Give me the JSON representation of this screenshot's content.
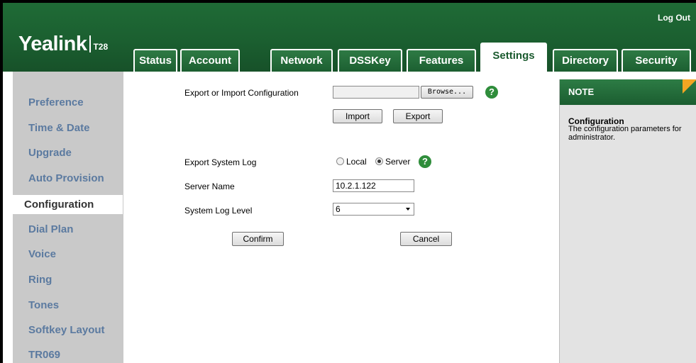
{
  "header": {
    "logo_brand": "Yealink",
    "logo_model": "T28",
    "logout_label": "Log Out",
    "accent_color": "#1b5f30"
  },
  "tabs": [
    {
      "label": "Status"
    },
    {
      "label": "Account"
    },
    {
      "label": "Network"
    },
    {
      "label": "DSSKey"
    },
    {
      "label": "Features"
    },
    {
      "label": "Settings",
      "active": true
    },
    {
      "label": "Directory"
    },
    {
      "label": "Security"
    }
  ],
  "sidebar": {
    "items": [
      {
        "label": "Preference"
      },
      {
        "label": "Time & Date"
      },
      {
        "label": "Upgrade"
      },
      {
        "label": "Auto Provision"
      },
      {
        "label": "Configuration",
        "active": true
      },
      {
        "label": "Dial Plan"
      },
      {
        "label": "Voice"
      },
      {
        "label": "Ring"
      },
      {
        "label": "Tones"
      },
      {
        "label": "Softkey Layout"
      },
      {
        "label": "TR069"
      }
    ]
  },
  "form": {
    "export_import_label": "Export or Import Configuration",
    "file_value": "",
    "browse_label": "Browse...",
    "import_label": "Import",
    "export_label": "Export",
    "export_log_label": "Export System Log",
    "radio_local_label": "Local",
    "radio_server_label": "Server",
    "radio_selected": "Server",
    "server_name_label": "Server Name",
    "server_name_value": "10.2.1.122",
    "log_level_label": "System Log Level",
    "log_level_value": "6",
    "confirm_label": "Confirm",
    "cancel_label": "Cancel",
    "help_icon": "?"
  },
  "note": {
    "header": "NOTE",
    "title": "Configuration",
    "text": "The configuration parameters for administrator."
  }
}
